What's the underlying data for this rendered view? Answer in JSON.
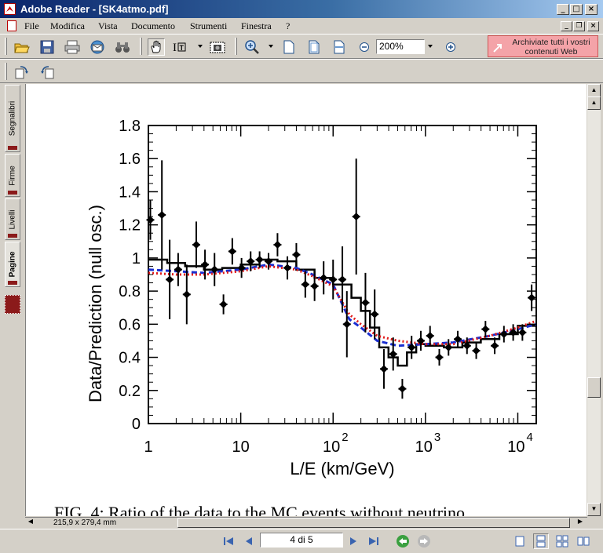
{
  "window": {
    "title": "Adobe Reader - [SK4atmo.pdf]",
    "controls": [
      "_",
      "□",
      "×"
    ],
    "doc_controls": [
      "_",
      "❐",
      "×"
    ]
  },
  "menu": [
    "File",
    "Modifica",
    "Vista",
    "Documento",
    "Strumenti",
    "Finestra",
    "?"
  ],
  "toolbar": {
    "zoom_value": "200%",
    "ad_text": "Archiviate tutti i vostri contenuti Web"
  },
  "sidebar_tabs": [
    "Segnalibri",
    "Firme",
    "Livelli",
    "Pagine"
  ],
  "document": {
    "caption": "FIG. 4: Ratio of the data to the MC events without neutrino"
  },
  "status": {
    "page_size": "215,9 x 279,4 mm",
    "page_indicator": "4 di 5"
  },
  "chart_data": {
    "type": "scatter",
    "ylabel": "Data/Prediction (null osc.)",
    "xlabel": "L/E (km/GeV)",
    "x_scale": "log",
    "xlim": [
      1,
      15849
    ],
    "ylim": [
      0,
      1.8
    ],
    "x_ticks": [
      {
        "value": 1,
        "base": "1",
        "exp": ""
      },
      {
        "value": 10,
        "base": "10",
        "exp": ""
      },
      {
        "value": 100,
        "base": "10",
        "exp": "2"
      },
      {
        "value": 1000,
        "base": "10",
        "exp": "3"
      },
      {
        "value": 10000,
        "base": "10",
        "exp": "4"
      }
    ],
    "y_ticks": [
      "0",
      "0.2",
      "0.4",
      "0.6",
      "0.8",
      "1",
      "1.2",
      "1.4",
      "1.6",
      "1.8"
    ],
    "y_tick_values": [
      0,
      0.2,
      0.4,
      0.6,
      0.8,
      1.0,
      1.2,
      1.4,
      1.6,
      1.8
    ],
    "grid": false,
    "series": [
      {
        "kind": "data_points",
        "points": [
          {
            "x": 1.05,
            "y": 1.23,
            "err": 0.12
          },
          {
            "x": 1.4,
            "y": 1.26,
            "err": 0.33
          },
          {
            "x": 1.7,
            "y": 0.87,
            "err": 0.24
          },
          {
            "x": 2.1,
            "y": 0.93,
            "err": 0.1
          },
          {
            "x": 2.6,
            "y": 0.78,
            "err": 0.18
          },
          {
            "x": 3.3,
            "y": 1.08,
            "err": 0.14
          },
          {
            "x": 4.1,
            "y": 0.96,
            "err": 0.09
          },
          {
            "x": 5.2,
            "y": 0.93,
            "err": 0.1
          },
          {
            "x": 6.5,
            "y": 0.72,
            "err": 0.06
          },
          {
            "x": 8.1,
            "y": 1.04,
            "err": 0.08
          },
          {
            "x": 10.2,
            "y": 0.94,
            "err": 0.06
          },
          {
            "x": 12.8,
            "y": 0.98,
            "err": 0.06
          },
          {
            "x": 16,
            "y": 0.99,
            "err": 0.05
          },
          {
            "x": 20,
            "y": 0.98,
            "err": 0.05
          },
          {
            "x": 25,
            "y": 1.08,
            "err": 0.07
          },
          {
            "x": 32,
            "y": 0.94,
            "err": 0.07
          },
          {
            "x": 40,
            "y": 1.02,
            "err": 0.07
          },
          {
            "x": 50,
            "y": 0.84,
            "err": 0.08
          },
          {
            "x": 63,
            "y": 0.83,
            "err": 0.09
          },
          {
            "x": 79,
            "y": 0.88,
            "err": 0.1
          },
          {
            "x": 100,
            "y": 0.87,
            "err": 0.12
          },
          {
            "x": 126,
            "y": 0.87,
            "err": 0.2
          },
          {
            "x": 141,
            "y": 0.6,
            "err": 0.2
          },
          {
            "x": 178,
            "y": 1.25,
            "err": 0.35
          },
          {
            "x": 224,
            "y": 0.73,
            "err": 0.18
          },
          {
            "x": 282,
            "y": 0.66,
            "err": 0.15
          },
          {
            "x": 355,
            "y": 0.33,
            "err": 0.12
          },
          {
            "x": 447,
            "y": 0.42,
            "err": 0.1
          },
          {
            "x": 562,
            "y": 0.21,
            "err": 0.06
          },
          {
            "x": 708,
            "y": 0.46,
            "err": 0.07
          },
          {
            "x": 891,
            "y": 0.5,
            "err": 0.06
          },
          {
            "x": 1122,
            "y": 0.53,
            "err": 0.06
          },
          {
            "x": 1413,
            "y": 0.4,
            "err": 0.05
          },
          {
            "x": 1778,
            "y": 0.46,
            "err": 0.05
          },
          {
            "x": 2239,
            "y": 0.51,
            "err": 0.05
          },
          {
            "x": 2818,
            "y": 0.47,
            "err": 0.05
          },
          {
            "x": 3548,
            "y": 0.44,
            "err": 0.05
          },
          {
            "x": 4467,
            "y": 0.57,
            "err": 0.05
          },
          {
            "x": 5623,
            "y": 0.47,
            "err": 0.05
          },
          {
            "x": 7079,
            "y": 0.54,
            "err": 0.05
          },
          {
            "x": 8913,
            "y": 0.55,
            "err": 0.05
          },
          {
            "x": 11220,
            "y": 0.55,
            "err": 0.05
          },
          {
            "x": 14125,
            "y": 0.76,
            "err": 0.08
          }
        ]
      },
      {
        "kind": "step_solid_black",
        "x": [
          1,
          1.6,
          2.5,
          4,
          6.3,
          10,
          16,
          25,
          40,
          63,
          100,
          158,
          200,
          251,
          316,
          398,
          501,
          631,
          794,
          1000,
          1585,
          2512,
          3981,
          6310,
          10000,
          15849
        ],
        "y": [
          0.99,
          0.97,
          0.95,
          0.93,
          0.94,
          0.96,
          0.99,
          0.98,
          0.93,
          0.88,
          0.84,
          0.76,
          0.68,
          0.58,
          0.46,
          0.4,
          0.35,
          0.43,
          0.48,
          0.47,
          0.46,
          0.49,
          0.51,
          0.54,
          0.59,
          0.6
        ]
      },
      {
        "kind": "dashed_blue",
        "x": [
          1,
          2,
          4,
          10,
          20,
          40,
          60,
          100,
          150,
          200,
          300,
          500,
          1000,
          2000,
          5000,
          10000,
          15849
        ],
        "y": [
          0.93,
          0.92,
          0.91,
          0.93,
          0.96,
          0.94,
          0.9,
          0.84,
          0.63,
          0.58,
          0.5,
          0.47,
          0.48,
          0.49,
          0.53,
          0.57,
          0.6
        ]
      },
      {
        "kind": "dotted_red",
        "x": [
          1,
          2,
          4,
          10,
          20,
          40,
          60,
          100,
          150,
          200,
          300,
          500,
          1000,
          2000,
          5000,
          10000,
          15849
        ],
        "y": [
          0.91,
          0.9,
          0.9,
          0.92,
          0.95,
          0.93,
          0.89,
          0.83,
          0.66,
          0.6,
          0.53,
          0.5,
          0.48,
          0.48,
          0.53,
          0.58,
          0.62
        ]
      }
    ]
  }
}
